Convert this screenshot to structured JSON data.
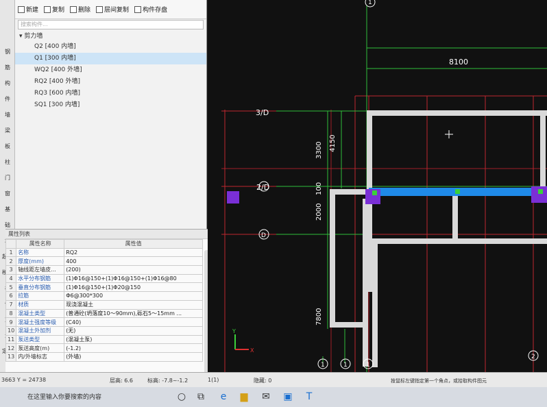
{
  "left_strip": [
    "钢",
    "筋",
    "构",
    "件",
    "墙",
    "梁",
    "板",
    "柱",
    "门",
    "窗",
    "基",
    "础",
    "垛",
    "起式",
    "楼层",
    "构",
    "体",
    "方",
    "元",
    "定义"
  ],
  "toolbar": {
    "new_label": "新建",
    "copy_label": "复制",
    "delete_label": "删除",
    "floor_copy_label": "层间复制",
    "save_label": "构件存盘"
  },
  "search_placeholder": "搜索构件...",
  "tree": {
    "category": "剪力墙",
    "items": [
      "Q2 [400 内墙]",
      "Q1 [300 内墙]",
      "WQ2 [400 外墙]",
      "RQ2 [400 外墙]",
      "RQ3 [600 内墙]",
      "SQ1 [300 内墙]"
    ],
    "selected_index": 1
  },
  "props": {
    "title": "属性列表",
    "col_name": "属性名称",
    "col_value": "属性值",
    "rows": [
      {
        "n": "1",
        "k": "名称",
        "v": "RQ2",
        "link": true
      },
      {
        "n": "2",
        "k": "厚度(mm)",
        "v": "400",
        "link": true
      },
      {
        "n": "3",
        "k": "轴线距左墙皮...",
        "v": "(200)",
        "link": false
      },
      {
        "n": "4",
        "k": "水平分布钢筋",
        "v": "(1)Φ16@150+(1)Φ16@150+(1)Φ16@80",
        "link": true
      },
      {
        "n": "5",
        "k": "垂直分布钢筋",
        "v": "(1)Φ16@150+(1)Φ20@150",
        "link": true
      },
      {
        "n": "6",
        "k": "拉筋",
        "v": "Φ6@300*300",
        "link": true
      },
      {
        "n": "7",
        "k": "材质",
        "v": "现浇混凝土",
        "link": true
      },
      {
        "n": "8",
        "k": "混凝土类型",
        "v": "(普通砼(坍落度10～90mm),砾石5～15mm ...",
        "link": true
      },
      {
        "n": "9",
        "k": "混凝土强度等级",
        "v": "(C40)",
        "link": true
      },
      {
        "n": "10",
        "k": "混凝土外加剂",
        "v": "(无)",
        "link": true
      },
      {
        "n": "11",
        "k": "泵送类型",
        "v": "(混凝土泵)",
        "link": true
      },
      {
        "n": "12",
        "k": "泵送高度(m)",
        "v": "(-1.2)",
        "link": false
      },
      {
        "n": "13",
        "k": "内/外墙标志",
        "v": "(外墙)",
        "link": false
      }
    ]
  },
  "cad": {
    "dims": {
      "top": "8100",
      "d3300": "3300",
      "d4150": "4150",
      "d100": "100",
      "d2000": "2000",
      "d7800": "7800"
    },
    "axes": {
      "a1": "1",
      "a3d": "3/D",
      "a2d": "2/D",
      "ad": "D",
      "a2": "2"
    }
  },
  "status": {
    "coord": "3663 Y = 24738",
    "floor_height": "层高: 6.6",
    "elevation": "标高: -7.8~-1.2",
    "count": "1(1)",
    "hidden": "隐藏: 0",
    "hint": "按鼠标左键指定第一个角点，或拾取构件图元"
  },
  "taskbar": {
    "search_text": "在这里输入你要搜索的内容"
  }
}
